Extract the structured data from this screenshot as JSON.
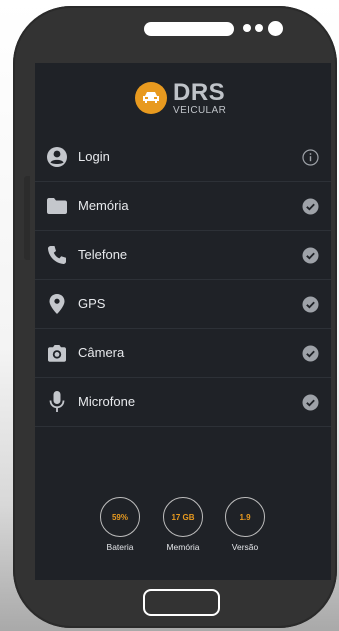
{
  "app": {
    "brand": {
      "title": "DRS",
      "subtitle": "VEICULAR",
      "icon": "car-icon",
      "accent_color": "#e89a1f"
    }
  },
  "menu": {
    "items": [
      {
        "label": "Login",
        "icon": "user-icon",
        "status_icon": "info-icon"
      },
      {
        "label": "Memória",
        "icon": "folder-icon",
        "status_icon": "check-circle-icon"
      },
      {
        "label": "Telefone",
        "icon": "phone-icon",
        "status_icon": "check-circle-icon"
      },
      {
        "label": "GPS",
        "icon": "map-pin-icon",
        "status_icon": "check-circle-icon"
      },
      {
        "label": "Câmera",
        "icon": "camera-icon",
        "status_icon": "check-circle-icon"
      },
      {
        "label": "Microfone",
        "icon": "microphone-icon",
        "status_icon": "check-circle-icon"
      }
    ]
  },
  "stats": {
    "battery": {
      "value": "59%",
      "label": "Bateria"
    },
    "memory": {
      "value": "17 GB",
      "label": "Memória"
    },
    "version": {
      "value": "1.9",
      "label": "Versão"
    }
  }
}
